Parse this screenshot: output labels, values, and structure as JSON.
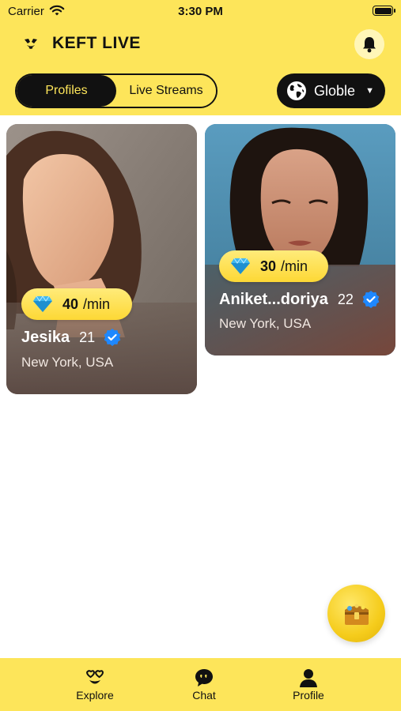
{
  "status_bar": {
    "carrier": "Carrier",
    "time": "3:30 PM"
  },
  "header": {
    "app_name": "KEFT LIVE"
  },
  "segment": {
    "profiles": "Profiles",
    "live_streams": "Live Streams",
    "selected": "Profiles"
  },
  "region": {
    "label": "Globle"
  },
  "profiles": [
    {
      "price": "40",
      "unit": "/min",
      "name": "Jesika",
      "age": "21",
      "location": "New York, USA",
      "verified": true
    },
    {
      "price": "30",
      "unit": "/min",
      "name": "Aniket...doriya",
      "age": "22",
      "location": "New York, USA",
      "verified": true
    }
  ],
  "nav": {
    "explore": "Explore",
    "chat": "Chat",
    "profile": "Profile"
  },
  "colors": {
    "brand_yellow": "#fde55a",
    "dark": "#111111",
    "verified_blue": "#1e88ff"
  }
}
